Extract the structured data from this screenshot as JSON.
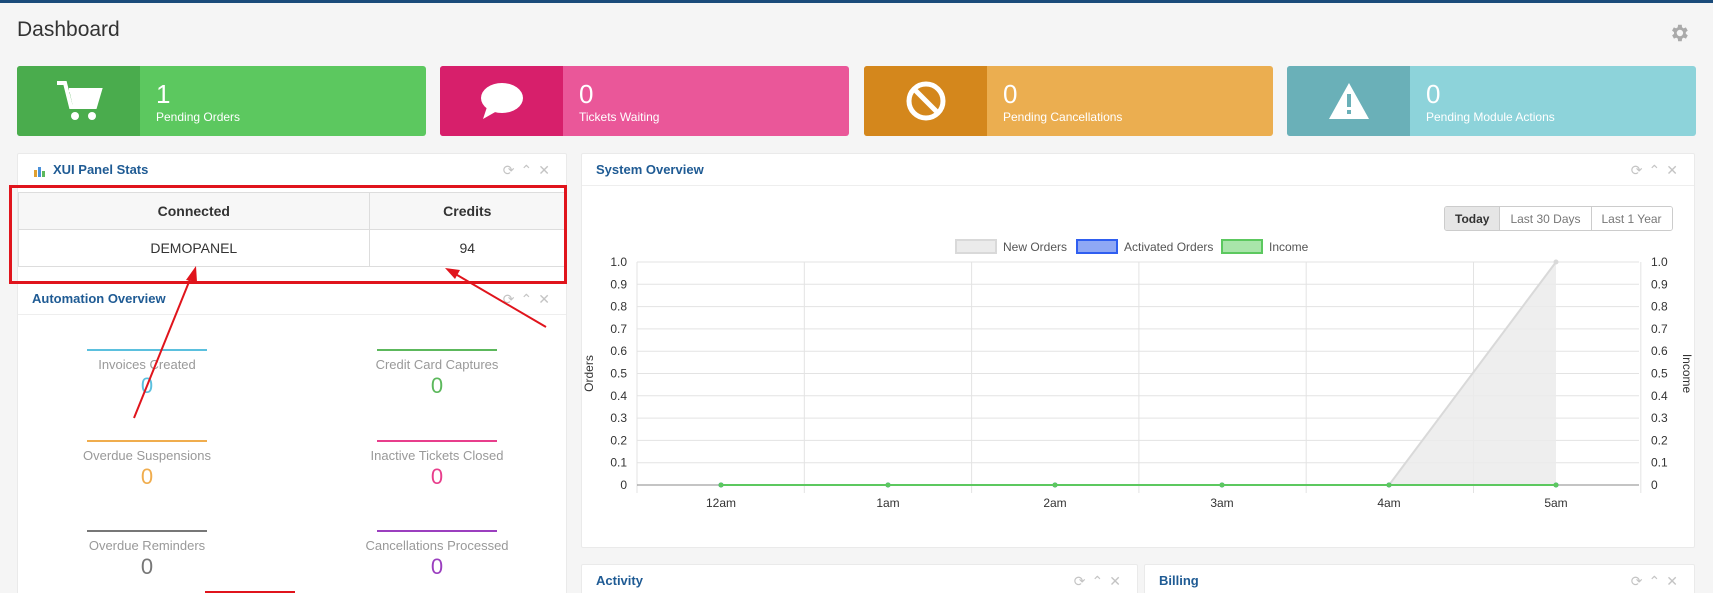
{
  "page": {
    "title": "Dashboard"
  },
  "stats": [
    {
      "value": "1",
      "label": "Pending Orders",
      "icon": "cart-icon",
      "color": "#5cc85f",
      "icon_bg": "#4aac4d"
    },
    {
      "value": "0",
      "label": "Tickets Waiting",
      "icon": "chat-bubble-icon",
      "color": "#ea5799",
      "icon_bg": "#d71f6b"
    },
    {
      "value": "0",
      "label": "Pending Cancellations",
      "icon": "ban-icon",
      "color": "#ebae50",
      "icon_bg": "#d4871c"
    },
    {
      "value": "0",
      "label": "Pending Module Actions",
      "icon": "warning-icon",
      "color": "#8dd3da",
      "icon_bg": "#6ab0b8"
    }
  ],
  "xui": {
    "title": "XUI Panel Stats",
    "headers": [
      "Connected",
      "Credits"
    ],
    "rows": [
      [
        "DEMOPANEL",
        "94"
      ]
    ]
  },
  "automation": {
    "title": "Automation Overview",
    "items": [
      {
        "label": "Invoices Created",
        "value": "0",
        "color": "#5bc0de"
      },
      {
        "label": "Credit Card Captures",
        "value": "0",
        "color": "#5cb85c"
      },
      {
        "label": "Overdue Suspensions",
        "value": "0",
        "color": "#f0ad4e"
      },
      {
        "label": "Inactive Tickets Closed",
        "value": "0",
        "color": "#e83e8c"
      },
      {
        "label": "Overdue Reminders",
        "value": "0",
        "color": "#777777"
      },
      {
        "label": "Cancellations Processed",
        "value": "0",
        "color": "#9b3fbf"
      }
    ]
  },
  "system": {
    "title": "System Overview",
    "ranges": [
      "Today",
      "Last 30 Days",
      "Last 1 Year"
    ],
    "active_range": "Today"
  },
  "activity": {
    "title": "Activity"
  },
  "billing": {
    "title": "Billing"
  },
  "chart_data": {
    "type": "line",
    "categories": [
      "12am",
      "1am",
      "2am",
      "3am",
      "4am",
      "5am"
    ],
    "series": [
      {
        "name": "New Orders",
        "values": [
          0,
          0,
          0,
          0,
          0,
          1
        ],
        "color": "#d9d9d9",
        "fill": "#ebebeb",
        "axis": "left"
      },
      {
        "name": "Activated Orders",
        "values": [
          0,
          0,
          0,
          0,
          0,
          0
        ],
        "color": "#2f5ef0",
        "fill": "#8fa8f5",
        "axis": "left"
      },
      {
        "name": "Income",
        "values": [
          0,
          0,
          0,
          0,
          0,
          0
        ],
        "color": "#5cc85f",
        "fill": "#a9e5aa",
        "axis": "right"
      }
    ],
    "ylabel": "Orders",
    "y2label": "Income",
    "ylim": [
      0,
      1
    ],
    "y2lim": [
      0,
      1
    ],
    "yticks": [
      "0",
      "0.1",
      "0.2",
      "0.3",
      "0.4",
      "0.5",
      "0.6",
      "0.7",
      "0.8",
      "0.9",
      "1.0"
    ],
    "legend": "top-center",
    "grid": true
  }
}
